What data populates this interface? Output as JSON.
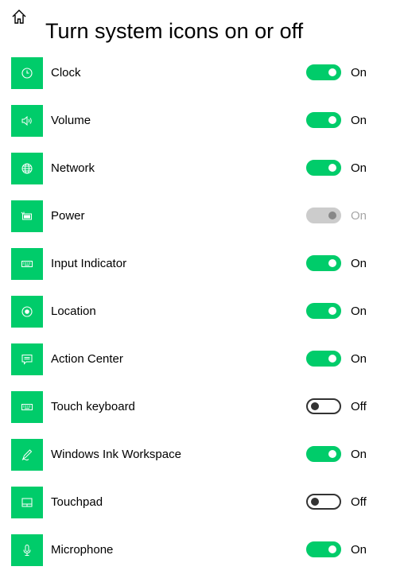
{
  "header": {
    "title": "Turn system icons on or off",
    "home_icon": "home-icon"
  },
  "colors": {
    "accent": "#00cc6a",
    "disabled_track": "#cccccc",
    "disabled_text": "#a6a6a6"
  },
  "items": [
    {
      "label": "Clock",
      "icon": "clock-icon",
      "state": "On",
      "checked": true,
      "disabled": false
    },
    {
      "label": "Volume",
      "icon": "volume-icon",
      "state": "On",
      "checked": true,
      "disabled": false
    },
    {
      "label": "Network",
      "icon": "network-globe-icon",
      "state": "On",
      "checked": true,
      "disabled": false
    },
    {
      "label": "Power",
      "icon": "battery-icon",
      "state": "On",
      "checked": true,
      "disabled": true
    },
    {
      "label": "Input Indicator",
      "icon": "keyboard-icon",
      "state": "On",
      "checked": true,
      "disabled": false
    },
    {
      "label": "Location",
      "icon": "location-icon",
      "state": "On",
      "checked": true,
      "disabled": false
    },
    {
      "label": "Action Center",
      "icon": "action-center-icon",
      "state": "On",
      "checked": true,
      "disabled": false
    },
    {
      "label": "Touch keyboard",
      "icon": "touch-keyboard-icon",
      "state": "Off",
      "checked": false,
      "disabled": false
    },
    {
      "label": "Windows Ink Workspace",
      "icon": "pen-icon",
      "state": "On",
      "checked": true,
      "disabled": false
    },
    {
      "label": "Touchpad",
      "icon": "touchpad-icon",
      "state": "Off",
      "checked": false,
      "disabled": false
    },
    {
      "label": "Microphone",
      "icon": "microphone-icon",
      "state": "On",
      "checked": true,
      "disabled": false
    }
  ]
}
